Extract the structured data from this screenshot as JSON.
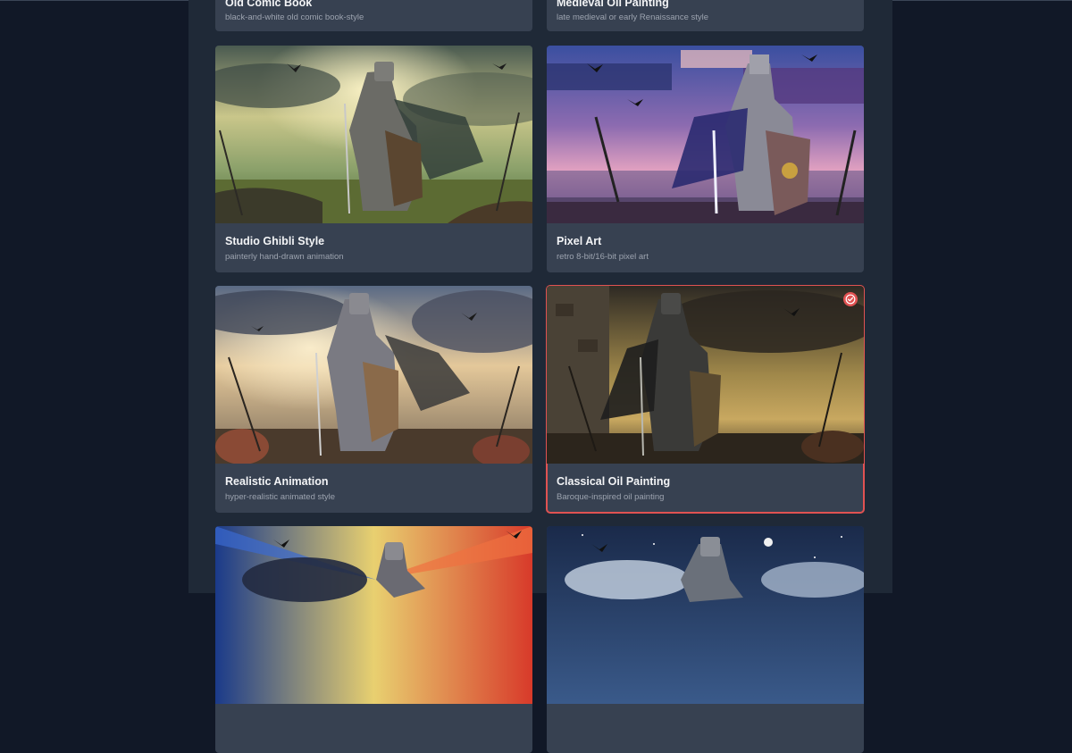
{
  "styles": [
    {
      "title": "Old Comic Book",
      "desc": "black-and-white old comic book-style",
      "selected": false
    },
    {
      "title": "Medieval Oil Painting",
      "desc": "late medieval or early Renaissance style",
      "selected": false
    },
    {
      "title": "Studio Ghibli Style",
      "desc": "painterly hand-drawn animation",
      "selected": false
    },
    {
      "title": "Pixel Art",
      "desc": "retro 8-bit/16-bit pixel art",
      "selected": false
    },
    {
      "title": "Realistic Animation",
      "desc": "hyper-realistic animated style",
      "selected": false
    },
    {
      "title": "Classical Oil Painting",
      "desc": "Baroque-inspired oil painting",
      "selected": true
    }
  ],
  "colors": {
    "accent": "#e05252",
    "card": "#374151",
    "panel": "#1f2937",
    "page": "#111827"
  },
  "icons": {
    "selected": "check-circle-icon"
  }
}
